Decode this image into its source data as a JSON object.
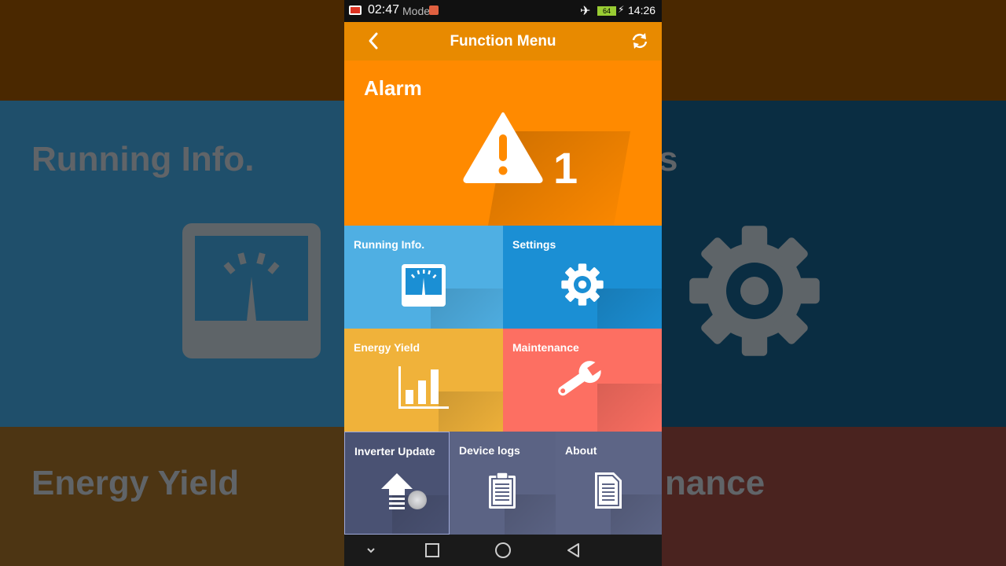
{
  "background": {
    "left_texts": [
      "Running Info.",
      "Energy Yield"
    ],
    "right_texts": [
      "s",
      "nance"
    ]
  },
  "status_bar": {
    "recording_time": "02:47",
    "mode_text": "Mode",
    "battery_level": "64",
    "clock": "14:26"
  },
  "app_bar": {
    "title": "Function Menu"
  },
  "alarm": {
    "title": "Alarm",
    "count": "1"
  },
  "tiles": {
    "running_info": "Running Info.",
    "settings": "Settings",
    "energy_yield": "Energy Yield",
    "maintenance": "Maintenance",
    "inverter_update": "Inverter Update",
    "device_logs": "Device logs",
    "about": "About"
  },
  "colors": {
    "app_bar": "#e88a00",
    "alarm": "#ff8a00",
    "running_info": "#4fafe3",
    "settings": "#1b8fd4",
    "energy_yield": "#f0b23a",
    "maintenance": "#fd6f62",
    "bottom_tiles": "#5b6384"
  },
  "icons": {
    "back": "back-arrow-icon",
    "refresh": "refresh-icon",
    "alarm": "warning-icon",
    "running_info": "gauge-icon",
    "settings": "gear-icon",
    "energy_yield": "bar-chart-icon",
    "maintenance": "wrench-icon",
    "inverter_update": "upload-icon",
    "device_logs": "clipboard-icon",
    "about": "document-icon"
  }
}
